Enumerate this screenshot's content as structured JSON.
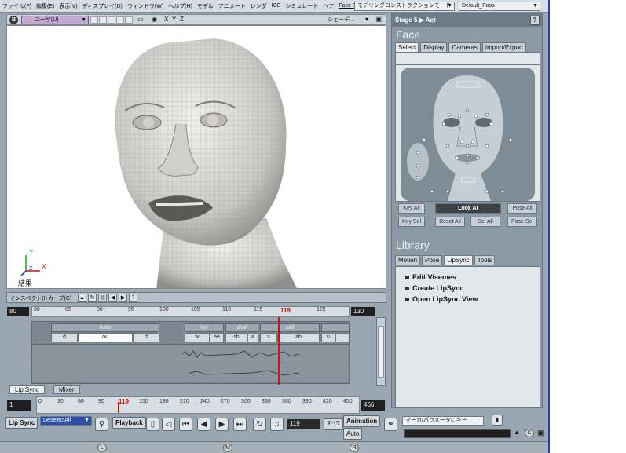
{
  "menu": {
    "items": [
      "ファイル(F)",
      "編集(E)",
      "表示(V)",
      "ディスプレイ(D)",
      "ウィンドウ(W)",
      "ヘルプ(H)",
      "モデル",
      "アニメート",
      "レンダ",
      "ICE",
      "シミュレート",
      "ヘア",
      "Face Robot"
    ],
    "mode_combo": "モデリングコンストラクションモード",
    "pass_combo": "Default_Pass"
  },
  "viewport": {
    "letter": "B",
    "view_name": "ユーザ(U)",
    "axes": [
      "X",
      "Y",
      "Z"
    ],
    "shading_label": "シェーデ...",
    "result_label": "結果",
    "axis_labels": {
      "x": "X",
      "y": "Y",
      "z": "Z"
    }
  },
  "right_panel": {
    "breadcrumb": "Stage 5 ▶ Act",
    "help": "?",
    "face": {
      "title": "Face",
      "tabs": [
        "Select",
        "Display",
        "Cameras",
        "Import/Export"
      ],
      "active_tab": "Select",
      "buttons_row1": [
        "Key All",
        "Look At",
        "Pose All"
      ],
      "buttons_row2": [
        "Key Sel",
        "Reset All",
        "Sel All",
        "Pose Sel"
      ]
    },
    "library": {
      "title": "Library",
      "tabs": [
        "Motion",
        "Pose",
        "LipSync",
        "Tools"
      ],
      "active_tab": "LipSync",
      "items": [
        "Edit Visemes",
        "Create LipSync",
        "Open LipSync View"
      ]
    }
  },
  "lipsync": {
    "toolbar": {
      "inspect": "インスペクト(I)",
      "curves": "カーブ(C)"
    },
    "range_start": "80",
    "range_end": "130",
    "ruler_ticks": [
      "80",
      "85",
      "90",
      "95",
      "100",
      "105",
      "110",
      "115",
      "119",
      "125"
    ],
    "current_frame": "119",
    "words": [
      "dude",
      "We",
      "shall",
      "sail"
    ],
    "phonemes": [
      "d",
      "ou",
      "d",
      "w",
      "ee",
      "sh",
      "a",
      "s",
      "ah",
      "u"
    ],
    "tabs": [
      "Lip Sync",
      "Mixer"
    ],
    "active_tab": "Lip Sync"
  },
  "timeline": {
    "start": "1",
    "end": "466",
    "ticks": [
      "0",
      "30",
      "60",
      "90",
      "150",
      "180",
      "210",
      "240",
      "270",
      "300",
      "330",
      "360",
      "390",
      "420",
      "450"
    ],
    "current": "119"
  },
  "playback": {
    "mode_label": "Lip Sync",
    "deselect_combo": "DeselectAll",
    "playback_label": "Playback",
    "frame_field": "119",
    "all_button": "すべて",
    "animation_label": "Animation",
    "auto_label": "Auto",
    "status_field": "マーカ/パラメータにキー",
    "mouse_buttons": [
      "L",
      "M",
      "R"
    ]
  },
  "colors": {
    "playhead": "#cc1111",
    "app_bg": "#9aa6b1",
    "view_combo": "#c3a9d2"
  }
}
